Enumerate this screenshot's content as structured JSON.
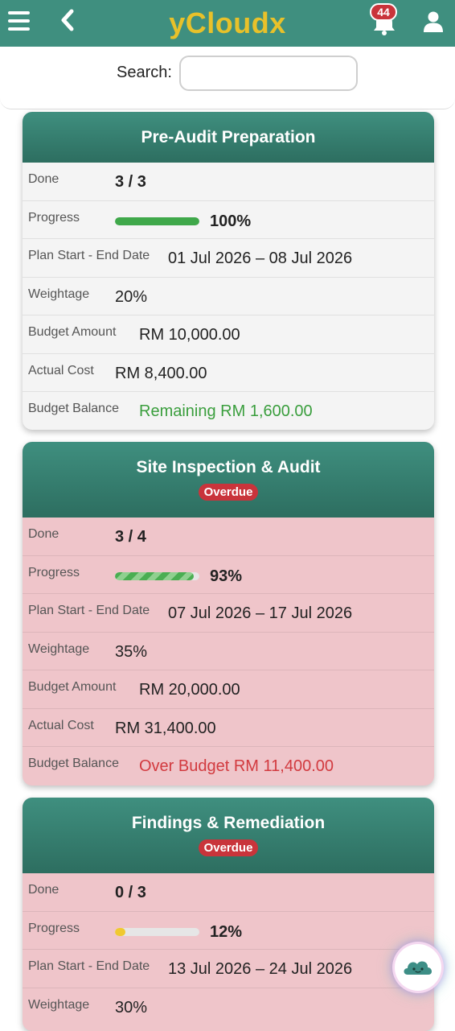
{
  "app": {
    "title": "yCloudx",
    "notification_count": "44"
  },
  "search": {
    "label": "Search:",
    "value": "",
    "placeholder": ""
  },
  "labels": {
    "done": "Done",
    "progress": "Progress",
    "dates": "Plan Start - End Date",
    "weightage": "Weightage",
    "budget_amount": "Budget Amount",
    "actual_cost": "Actual Cost",
    "budget_balance": "Budget Balance"
  },
  "cards": [
    {
      "title": "Pre-Audit Preparation",
      "status": "",
      "done": "3 / 3",
      "progress_value": 100,
      "progress_text": "100%",
      "dates": "01 Jul 2026 – 08 Jul 2026",
      "weightage": "20%",
      "budget_amount": "RM 10,000.00",
      "actual_cost": "RM 8,400.00",
      "budget_balance": "Remaining RM 1,600.00"
    },
    {
      "title": "Site Inspection & Audit",
      "status": "Overdue",
      "done": "3 / 4",
      "progress_value": 93,
      "progress_text": "93%",
      "dates": "07 Jul 2026 – 17 Jul 2026",
      "weightage": "35%",
      "budget_amount": "RM 20,000.00",
      "actual_cost": "RM 31,400.00",
      "budget_balance": "Over Budget RM 11,400.00"
    },
    {
      "title": "Findings & Remediation",
      "status": "Overdue",
      "done": "0 / 3",
      "progress_value": 12,
      "progress_text": "12%",
      "dates": "13 Jul 2026 – 24 Jul 2026",
      "weightage": "30%"
    }
  ],
  "colors": {
    "header": "#3f8f7f",
    "brand": "#e8c12a",
    "overdue_bg": "#efc5ca",
    "badge_red": "#c9343b",
    "remaining_green": "#3a9e3d",
    "over_budget_red": "#d23a3f"
  },
  "icons": [
    "menu-icon",
    "back-arrow-icon",
    "bell-icon",
    "user-icon",
    "cloud-assistant-icon"
  ]
}
